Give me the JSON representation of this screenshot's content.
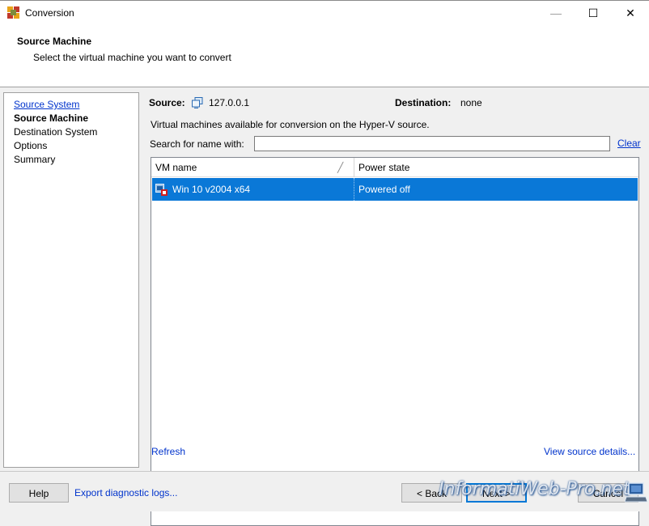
{
  "window": {
    "title": "Conversion",
    "minimize_glyph": "—",
    "maximize_glyph": "☐",
    "close_glyph": "✕",
    "icon": "app-icon"
  },
  "header": {
    "title": "Source Machine",
    "subtitle": "Select the virtual machine you want to convert"
  },
  "nav": {
    "items": [
      {
        "label": "Source System",
        "state": "link"
      },
      {
        "label": "Source Machine",
        "state": "current"
      },
      {
        "label": "Destination System",
        "state": "normal"
      },
      {
        "label": "Options",
        "state": "normal"
      },
      {
        "label": "Summary",
        "state": "normal"
      }
    ]
  },
  "source": {
    "label": "Source:",
    "value": "127.0.0.1",
    "icon": "server-icon"
  },
  "destination": {
    "label": "Destination:",
    "value": "none"
  },
  "description": "Virtual machines available for conversion on the Hyper-V source.",
  "search": {
    "label": "Search for name with:",
    "value": "",
    "placeholder": "",
    "clear_label": "Clear"
  },
  "table": {
    "columns": [
      "VM name",
      "Power state"
    ],
    "rows": [
      {
        "name": "Win 10 v2004 x64",
        "power_state": "Powered off",
        "selected": true,
        "icon": "vm-icon"
      }
    ]
  },
  "links": {
    "refresh": "Refresh",
    "view_source_details": "View source details..."
  },
  "footer": {
    "help": "Help",
    "export_logs": "Export diagnostic logs...",
    "back": "< Back",
    "next": "Next >",
    "cancel": "Cancel"
  },
  "watermark": {
    "text": "InformatiWeb-Pro.net"
  },
  "colors": {
    "selection": "#0a78d7",
    "link": "#0033cc",
    "focus": "#0078d7"
  }
}
